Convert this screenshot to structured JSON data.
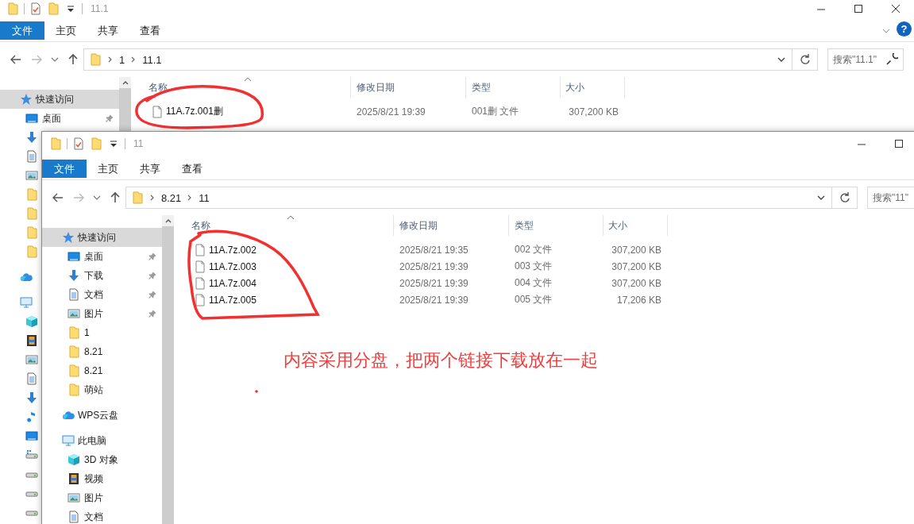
{
  "windows": [
    {
      "title": "11.1",
      "controls": [
        {
          "kind": "minimize"
        },
        {
          "kind": "maximize"
        },
        {
          "kind": "close"
        }
      ],
      "ribbon_tabs": [
        {
          "label": "文件",
          "selected": true
        },
        {
          "label": "主页",
          "selected": false
        },
        {
          "label": "共享",
          "selected": false
        },
        {
          "label": "查看",
          "selected": false
        }
      ],
      "help_button": "?",
      "path": [
        "1",
        "11.1"
      ],
      "search": {
        "placeholder": "搜索\"11.1\"",
        "icon": true
      },
      "sidebar": [
        {
          "label": "快速访问",
          "kind": "star",
          "selected": true,
          "children": [
            {
              "label": "桌面",
              "kind": "desktop",
              "pinned": true,
              "selected": false
            },
            {
              "kind": "download",
              "selected": false
            },
            {
              "kind": "document",
              "selected": false
            },
            {
              "kind": "pictures",
              "selected": false
            },
            {
              "kind": "folder",
              "selected": false
            },
            {
              "kind": "folder",
              "selected": false
            },
            {
              "kind": "folder",
              "selected": false
            },
            {
              "kind": "folder",
              "selected": false
            }
          ]
        },
        {
          "kind": "cloud",
          "selected": false
        },
        {
          "kind": "pc",
          "selected": false,
          "children": [
            {
              "kind": "cube",
              "selected": false
            },
            {
              "kind": "video",
              "selected": false
            },
            {
              "kind": "pictures",
              "selected": false
            },
            {
              "kind": "document",
              "selected": false
            },
            {
              "kind": "download",
              "selected": false
            },
            {
              "kind": "music",
              "selected": false
            },
            {
              "kind": "desktop",
              "selected": false
            },
            {
              "kind": "drive-windows",
              "selected": false
            },
            {
              "kind": "drive",
              "selected": false
            },
            {
              "kind": "drive",
              "selected": false
            },
            {
              "kind": "drive",
              "selected": false
            }
          ]
        }
      ],
      "columns": [
        "名称",
        "修改日期",
        "类型",
        "大小"
      ],
      "files": [
        {
          "name": "11A.7z.001删",
          "modified": "2025/8/21 19:39",
          "type": "001删 文件",
          "size": "307,200 KB"
        }
      ],
      "annotations": [
        {
          "kind": "circle"
        }
      ]
    },
    {
      "title": "11",
      "controls": [
        {
          "kind": "minimize"
        },
        {
          "kind": "maximize"
        }
      ],
      "ribbon_tabs": [
        {
          "label": "文件",
          "selected": true
        },
        {
          "label": "主页",
          "selected": false
        },
        {
          "label": "共享",
          "selected": false
        },
        {
          "label": "查看",
          "selected": false
        }
      ],
      "path": [
        "8.21",
        "11"
      ],
      "search": {
        "placeholder": "搜索\"11\"",
        "icon": false
      },
      "sidebar": [
        {
          "label": "快速访问",
          "kind": "star",
          "selected": true,
          "children": [
            {
              "label": "桌面",
              "kind": "desktop",
              "pinned": true,
              "selected": false
            },
            {
              "label": "下载",
              "kind": "download",
              "pinned": true,
              "selected": false
            },
            {
              "label": "文档",
              "kind": "document",
              "pinned": true,
              "selected": false
            },
            {
              "label": "图片",
              "kind": "pictures",
              "pinned": true,
              "selected": false
            },
            {
              "label": "1",
              "kind": "folder",
              "selected": false
            },
            {
              "label": "8.21",
              "kind": "folder",
              "selected": false
            },
            {
              "label": "8.21",
              "kind": "folder",
              "selected": false
            },
            {
              "label": "萌站",
              "kind": "folder",
              "selected": false
            }
          ]
        },
        {
          "label": "WPS云盘",
          "kind": "cloud",
          "selected": false
        },
        {
          "label": "此电脑",
          "kind": "pc",
          "selected": false,
          "children": [
            {
              "label": "3D 对象",
              "kind": "cube",
              "selected": false
            },
            {
              "label": "视频",
              "kind": "video",
              "selected": false
            },
            {
              "label": "图片",
              "kind": "pictures",
              "selected": false
            },
            {
              "label": "文档",
              "kind": "document",
              "selected": false
            }
          ]
        }
      ],
      "columns": [
        "名称",
        "修改日期",
        "类型",
        "大小"
      ],
      "files": [
        {
          "name": "11A.7z.002",
          "modified": "2025/8/21 19:35",
          "type": "002 文件",
          "size": "307,200 KB"
        },
        {
          "name": "11A.7z.003",
          "modified": "2025/8/21 19:39",
          "type": "003 文件",
          "size": "307,200 KB"
        },
        {
          "name": "11A.7z.004",
          "modified": "2025/8/21 19:39",
          "type": "004 文件",
          "size": "307,200 KB"
        },
        {
          "name": "11A.7z.005",
          "modified": "2025/8/21 19:39",
          "type": "005 文件",
          "size": "17,206 KB"
        }
      ],
      "annotations": [
        {
          "kind": "loop"
        },
        {
          "kind": "dot"
        },
        {
          "kind": "note",
          "text": "内容采用分盘，把两个链接下载放在一起"
        }
      ]
    }
  ]
}
